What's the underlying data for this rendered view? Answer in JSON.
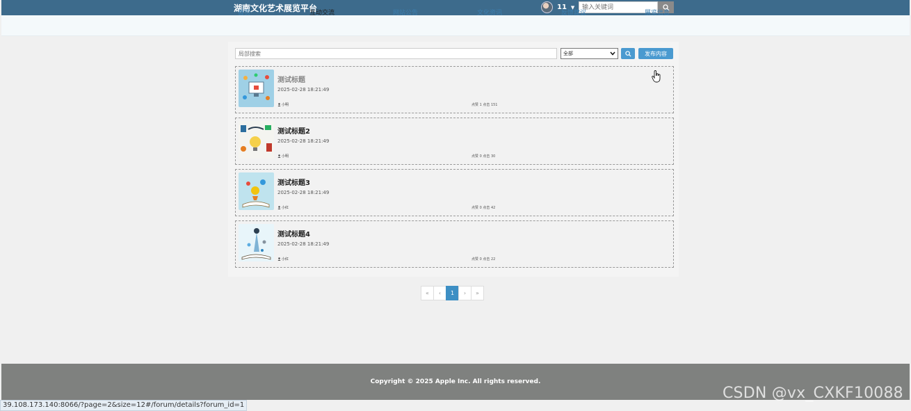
{
  "header": {
    "title": "湖南文化艺术展览平台",
    "username": "11",
    "search_placeholder": "输入关键词"
  },
  "nav": {
    "items": [
      {
        "label": "首页",
        "active": false
      },
      {
        "label": "互动交流",
        "active": true
      },
      {
        "label": "网站公告",
        "active": false
      },
      {
        "label": "文化资讯",
        "active": false
      },
      {
        "label": "反馈建议",
        "active": false
      },
      {
        "label": "展览信息",
        "active": false
      }
    ]
  },
  "toolbar": {
    "local_search_placeholder": "局部搜索",
    "category_selected": "全部",
    "publish_label": "发布内容"
  },
  "posts": [
    {
      "title": "测试标题",
      "date": "2025-02-28 18:21:49",
      "author": "小明",
      "stats": "点赞 1 点击 151"
    },
    {
      "title": "测试标题2",
      "date": "2025-02-28 18:21:49",
      "author": "小明",
      "stats": "点赞 0 点击 30"
    },
    {
      "title": "测试标题3",
      "date": "2025-02-28 18:21:49",
      "author": "小红",
      "stats": "点赞 0 点击 42"
    },
    {
      "title": "测试标题4",
      "date": "2025-02-28 18:21:49",
      "author": "小红",
      "stats": "点赞 0 点击 22"
    }
  ],
  "pagination": {
    "first": "«",
    "prev": "‹",
    "current": "1",
    "next": "›",
    "last": "»"
  },
  "footer": {
    "copyright": "Copyright © 2025 Apple Inc. All rights reserved."
  },
  "status_url": "39.108.173.140:8066/?page=2&size=12#/forum/details?forum_id=1",
  "watermark": "CSDN @vx_CXKF10088",
  "colors": {
    "topbar": "#3d6b8c",
    "accent": "#4a9ad0",
    "footer": "#7f817f"
  }
}
